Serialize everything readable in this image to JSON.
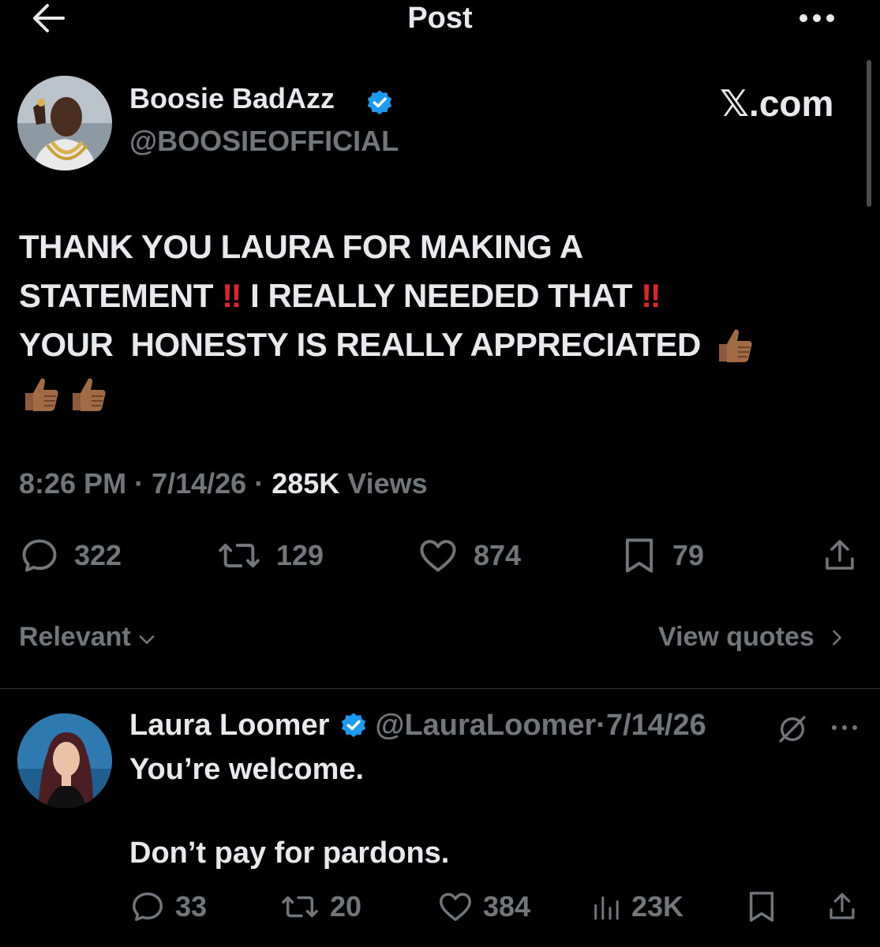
{
  "header": {
    "title": "Post"
  },
  "main_post": {
    "author_name": "Boosie BadAzz",
    "author_handle": "@BOOSIEOFFICIAL",
    "watermark": "𝕏.com",
    "text": {
      "line1": "THANK YOU LAURA FOR MAKING A",
      "line2a": "STATEMENT ",
      "emoji_bang": "‼",
      "line2b": " I REALLY NEEDED THAT ",
      "line3": "YOUR  HONESTY IS REALLY APPRECIATED "
    },
    "time": "8:26 PM",
    "date": "7/14/26",
    "views_count": "285K",
    "views_label": " Views",
    "sep": " · ",
    "replies": "322",
    "reposts": "129",
    "likes": "874",
    "bookmarks": "79"
  },
  "sort": {
    "label": "Relevant",
    "view_quotes": "View quotes"
  },
  "reply": {
    "author_name": "Laura Loomer",
    "author_handle": "@LauraLoomer",
    "dot": "·",
    "date": "7/14/26",
    "text_line1": "You’re welcome.",
    "text_line2": "Don’t pay for pardons.",
    "replies": "33",
    "reposts": "20",
    "likes": "384",
    "views": "23K"
  },
  "colors": {
    "background": "#000000",
    "text_primary": "#e7e9ea",
    "text_secondary": "#71767b",
    "verified_badge": "#1d9bf0",
    "emoji_red": "#e0242b",
    "thumbs_skin": "#a16b45"
  },
  "icons": {
    "back": "arrow-left-icon",
    "more": "more-horizontal-icon",
    "verified": "verified-badge-icon",
    "reply": "speech-bubble-icon",
    "repost": "repost-arrows-icon",
    "like": "heart-icon",
    "bookmark": "bookmark-icon",
    "share": "share-upload-icon",
    "views": "bar-chart-icon",
    "grok": "grok-icon",
    "thumbs_up": "thumbs-up-emoji"
  }
}
